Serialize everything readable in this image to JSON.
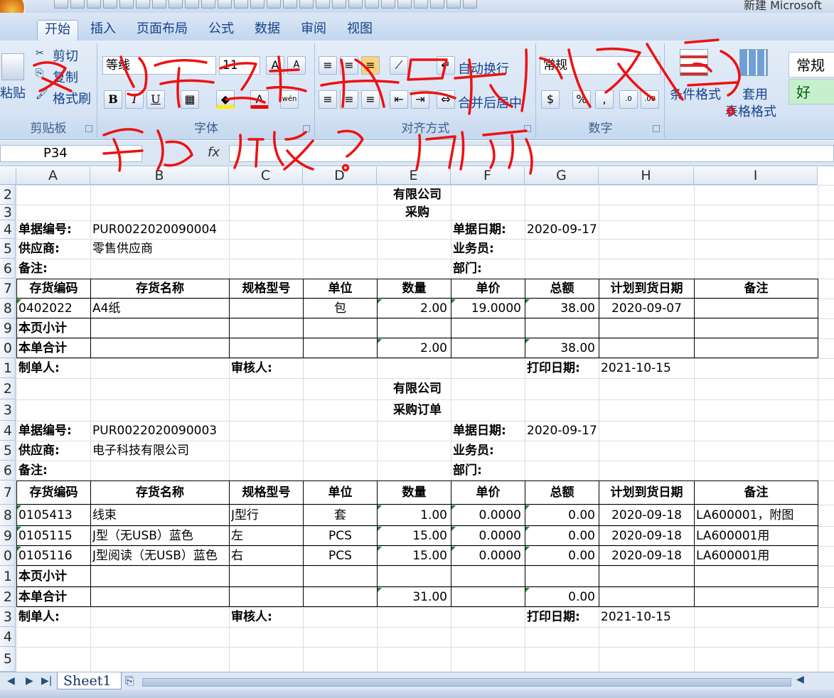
{
  "window": {
    "title": "新建 Microsoft"
  },
  "ribbon": {
    "tabs": [
      "开始",
      "插入",
      "页面布局",
      "公式",
      "数据",
      "审阅",
      "视图"
    ],
    "clipboard": {
      "paste": "粘贴",
      "cut": "剪切",
      "copy": "复制",
      "format_painter": "格式刷",
      "label": "剪贴板"
    },
    "font": {
      "name": "等线",
      "size": "11",
      "bold": "B",
      "italic": "I",
      "underline": "U",
      "label": "字体"
    },
    "alignment": {
      "wrap": "自动换行",
      "merge": "合并后居中",
      "label": "对齐方式"
    },
    "number": {
      "format": "常规",
      "percent": "%",
      "label": "数字"
    },
    "styles": {
      "conditional": "条件格式",
      "table_line1": "套用",
      "table_line2": "表格格式",
      "normal": "常规",
      "good": "好"
    }
  },
  "formula_bar": {
    "name_box": "P34",
    "fx": "fx"
  },
  "columns": [
    "A",
    "B",
    "C",
    "D",
    "E",
    "F",
    "G",
    "H",
    "I"
  ],
  "rows": [
    "2",
    "3",
    "4",
    "5",
    "6",
    "7",
    "8",
    "9",
    "0",
    "1",
    "2",
    "3",
    "4",
    "5",
    "6",
    "7",
    "8",
    "9",
    "0",
    "1",
    "2",
    "3",
    "4",
    "5"
  ],
  "doc1": {
    "company": "有限公司",
    "title": "采购",
    "no_label": "单据编号:",
    "no": "PUR0022020090004",
    "date_label": "单据日期:",
    "date": "2020-09-17",
    "supplier_label": "供应商:",
    "supplier": "零售供应商",
    "clerk_label": "业务员:",
    "memo_label": "备注:",
    "dept_label": "部门:",
    "headers": [
      "存货编码",
      "存货名称",
      "规格型号",
      "单位",
      "数量",
      "单价",
      "总额",
      "计划到货日期",
      "备注"
    ],
    "lines": [
      [
        "0402022",
        "A4纸",
        "",
        "包",
        "2.00",
        "19.0000",
        "38.00",
        "2020-09-07",
        ""
      ]
    ],
    "page_sub": "本页小计",
    "total": "本单合计",
    "total_qty": "2.00",
    "total_amt": "38.00",
    "maker": "制单人:",
    "auditor": "审核人:",
    "print_label": "打印日期:",
    "print_date": "2021-10-15"
  },
  "doc2": {
    "company": "有限公司",
    "title": "采购订单",
    "no_label": "单据编号:",
    "no": "PUR0022020090003",
    "date_label": "单据日期:",
    "date": "2020-09-17",
    "supplier_label": "供应商:",
    "supplier": "电子科技有限公司",
    "clerk_label": "业务员:",
    "memo_label": "备注:",
    "dept_label": "部门:",
    "headers": [
      "存货编码",
      "存货名称",
      "规格型号",
      "单位",
      "数量",
      "单价",
      "总额",
      "计划到货日期",
      "备注"
    ],
    "lines": [
      [
        "0105413",
        "线束",
        "J型行",
        "套",
        "1.00",
        "0.0000",
        "0.00",
        "2020-09-18",
        "LA600001，附图"
      ],
      [
        "0105115",
        "J型（无USB）蓝色",
        "左",
        "PCS",
        "15.00",
        "0.0000",
        "0.00",
        "2020-09-18",
        " LA600001用"
      ],
      [
        "0105116",
        "J型阅读（无USB）蓝色",
        "右",
        "PCS",
        "15.00",
        "0.0000",
        "0.00",
        "2020-09-18",
        " LA600001用"
      ]
    ],
    "page_sub": "本页小计",
    "total": "本单合计",
    "total_qty": "31.00",
    "total_amt": "0.00",
    "maker": "制单人:",
    "auditor": "审核人:",
    "print_label": "打印日期:",
    "print_date": "2021-10-15"
  },
  "sheet_tab": "Sheet1"
}
